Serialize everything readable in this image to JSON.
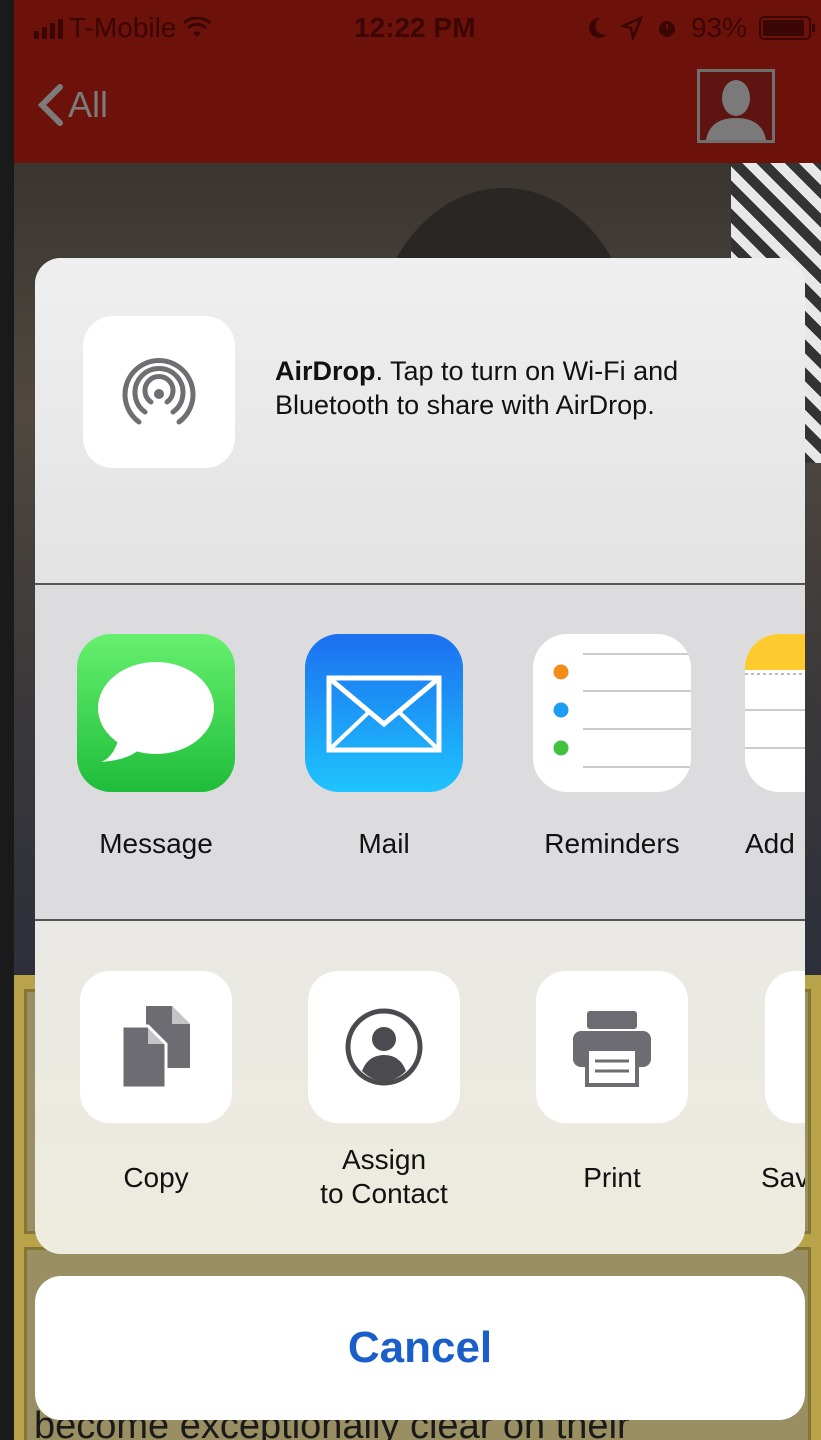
{
  "status_bar": {
    "carrier": "T-Mobile",
    "time": "12:22 PM",
    "battery": "93%",
    "battery_level": 0.93
  },
  "nav": {
    "back_label": "All"
  },
  "airdrop": {
    "title": "AirDrop",
    "message": ". Tap to turn on Wi-Fi and Bluetooth to share with AirDrop."
  },
  "apps": [
    {
      "label": "Message",
      "icon": "message-icon",
      "color": "#35c24b"
    },
    {
      "label": "Mail",
      "icon": "mail-icon",
      "color": "#1f8ef1"
    },
    {
      "label": "Reminders",
      "icon": "reminders-icon",
      "color": "#ffffff"
    },
    {
      "label": "Add",
      "icon": "notes-icon",
      "color": "#ffffff"
    }
  ],
  "actions": [
    {
      "label": "Copy",
      "icon": "copy-icon"
    },
    {
      "label": "Assign\nto Contact",
      "line1": "Assign",
      "line2": "to Contact",
      "icon": "contact-icon"
    },
    {
      "label": "Print",
      "icon": "print-icon"
    },
    {
      "label": "Sav",
      "icon": "save-icon"
    }
  ],
  "cancel_label": "Cancel",
  "background_text": "become exceptionally clear on their",
  "colors": {
    "nav_bg": "#6c120b",
    "cancel_text": "#1a5ec9",
    "sheet_bg": "#ebebee"
  }
}
